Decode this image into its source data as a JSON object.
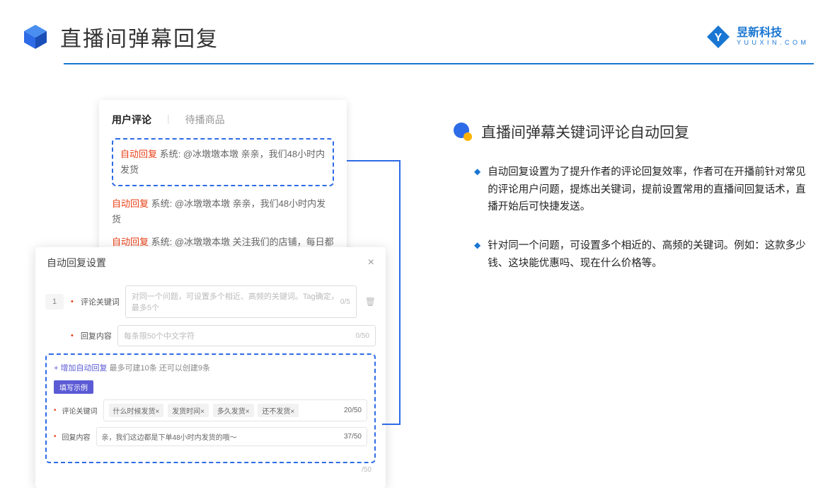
{
  "header": {
    "title": "直播间弹幕回复",
    "brand_cn": "昱新科技",
    "brand_en": "Y U U X I N . C O M"
  },
  "card1": {
    "tab_active": "用户评论",
    "tab_inactive": "待播商品",
    "reply_tag": "自动回复",
    "reply1": "系统: @冰墩墩本墩 亲亲，我们48小时内发货",
    "reply2": "系统: @冰墩墩本墩 亲亲，我们48小时内发货",
    "reply3": "系统: @冰墩墩本墩 关注我们的店铺，每日都有热门推荐呦～"
  },
  "card2": {
    "title": "自动回复设置",
    "close": "×",
    "idx": "1",
    "label_keyword": "评论关键词",
    "placeholder_keyword": "对同一个问题，可设置多个相近、高频的关键词。Tag确定，最多5个",
    "counter_keyword": "0/5",
    "label_content": "回复内容",
    "placeholder_content": "每条限50个中文字符",
    "counter_content": "0/50",
    "add_text": "+ 增加自动回复",
    "add_hint": "最多可建10条 还可以创建9条",
    "badge": "填写示例",
    "ex_label_keyword": "评论关键词",
    "ex_chip1": "什么时候发货×",
    "ex_chip2": "发货时间×",
    "ex_chip3": "多久发货×",
    "ex_chip4": "还不发货×",
    "ex_counter1": "20/50",
    "ex_label_content": "回复内容",
    "ex_content": "亲，我们这边都是下单48小时内发货的哦～",
    "ex_counter2": "37/50",
    "bottom_counter": "/50"
  },
  "right": {
    "section_title": "直播间弹幕关键词评论自动回复",
    "bullet1": "自动回复设置为了提升作者的评论回复效率，作者可在开播前针对常见的评论用户问题，提炼出关键词，提前设置常用的直播间回复话术，直播开始后可快捷发送。",
    "bullet2": "针对同一个问题，可设置多个相近的、高频的关键词。例如：这款多少钱、这块能优惠吗、现在什么价格等。"
  }
}
